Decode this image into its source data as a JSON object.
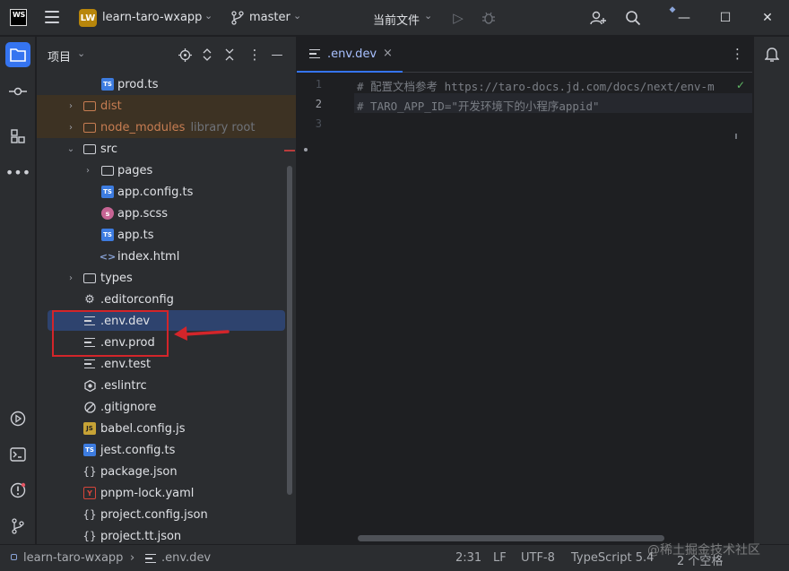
{
  "titlebar": {
    "app_logo": "WS",
    "project_badge": "LW",
    "project_name": "learn-taro-wxapp",
    "branch": "master",
    "run_config": "当前文件"
  },
  "project_panel": {
    "title": "项目",
    "tree": [
      {
        "name": "prod.ts",
        "icon": "ts-icon"
      },
      {
        "name": "dist",
        "icon": "folder-icon",
        "excluded": true
      },
      {
        "name": "node_modules",
        "hint": "library root",
        "icon": "folder-icon",
        "excluded": true
      },
      {
        "name": "src",
        "icon": "folder-icon"
      },
      {
        "name": "pages",
        "icon": "folder-icon"
      },
      {
        "name": "app.config.ts",
        "icon": "ts-icon"
      },
      {
        "name": "app.scss",
        "icon": "scss-icon"
      },
      {
        "name": "app.ts",
        "icon": "ts-icon"
      },
      {
        "name": "index.html",
        "icon": "html-icon"
      },
      {
        "name": "types",
        "icon": "folder-icon"
      },
      {
        "name": ".editorconfig",
        "icon": "gear-icon"
      },
      {
        "name": ".env.dev",
        "icon": "text-file-icon",
        "selected": true
      },
      {
        "name": ".env.prod",
        "icon": "text-file-icon"
      },
      {
        "name": ".env.test",
        "icon": "text-file-icon"
      },
      {
        "name": ".eslintrc",
        "icon": "eslint-icon"
      },
      {
        "name": ".gitignore",
        "icon": "gitignore-icon"
      },
      {
        "name": "babel.config.js",
        "icon": "js-icon"
      },
      {
        "name": "jest.config.ts",
        "icon": "ts-icon"
      },
      {
        "name": "package.json",
        "icon": "json-icon"
      },
      {
        "name": "pnpm-lock.yaml",
        "icon": "yaml-icon"
      },
      {
        "name": "project.config.json",
        "icon": "json-icon"
      },
      {
        "name": "project.tt.json",
        "icon": "json-icon"
      }
    ]
  },
  "editor": {
    "tab_label": ".env.dev",
    "line_numbers": [
      "1",
      "2",
      "3"
    ],
    "lines": [
      "# 配置文档参考 https://taro-docs.jd.com/docs/next/env-m",
      "# TARO_APP_ID=\"开发环境下的小程序appid\"",
      ""
    ]
  },
  "statusbar": {
    "breadcrumb_project": "learn-taro-wxapp",
    "breadcrumb_file": ".env.dev",
    "position": "2:31",
    "line_separator": "LF",
    "encoding": "UTF-8",
    "file_type": "TypeScript 5.4",
    "indent": "2 个空格"
  },
  "watermark": "@稀土掘金技术社区",
  "colors": {
    "accent": "#3574f0",
    "annotation_red": "#d3252a",
    "excluded_bg": "#3d3223",
    "selection_bg": "#2e436e"
  }
}
